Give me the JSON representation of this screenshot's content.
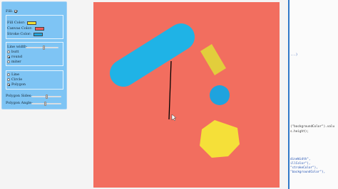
{
  "controls": {
    "fill_label": "Fill:",
    "fill_checked": true,
    "fill_color_label": "Fill Color:",
    "canvas_color_label": "Canvas Color:",
    "stroke_color_label": "Stroke Color:",
    "colors": {
      "fill": "#f2df36",
      "canvas": "#e85d5d",
      "stroke": "#1fa6df"
    },
    "line_width_label": "Line width:",
    "line_width_value": 0.55,
    "line_caps": [
      {
        "label": "butt",
        "selected": false
      },
      {
        "label": "round",
        "selected": true
      },
      {
        "label": "miter",
        "selected": false
      }
    ],
    "shapes": [
      {
        "label": "Line",
        "selected": false
      },
      {
        "label": "Circle",
        "selected": false
      },
      {
        "label": "Polygon",
        "selected": true
      }
    ],
    "polygon_sides_label": "Polygon Sides:",
    "polygon_sides_value": 0.52,
    "polygon_angle_label": "Polygon Angle:",
    "polygon_angle_value": 0.45
  },
  "canvas": {
    "background": "#f26e5f",
    "shapes_colors": {
      "capsule": "#1fb3e6",
      "rect": "#e2ce3c",
      "circle": "#1fa3de",
      "heptagon": "#f5e039",
      "line": "#000000"
    }
  },
  "code": {
    "line1": "...)",
    "line2": "(\"backgroundColor\").valu",
    "line3": "s.height);",
    "line4": "dineWidth\",",
    "line5": "illColor\"),",
    "line6": "\"strokeColor\"),",
    "line7": "\"backgroundColor\"),"
  }
}
